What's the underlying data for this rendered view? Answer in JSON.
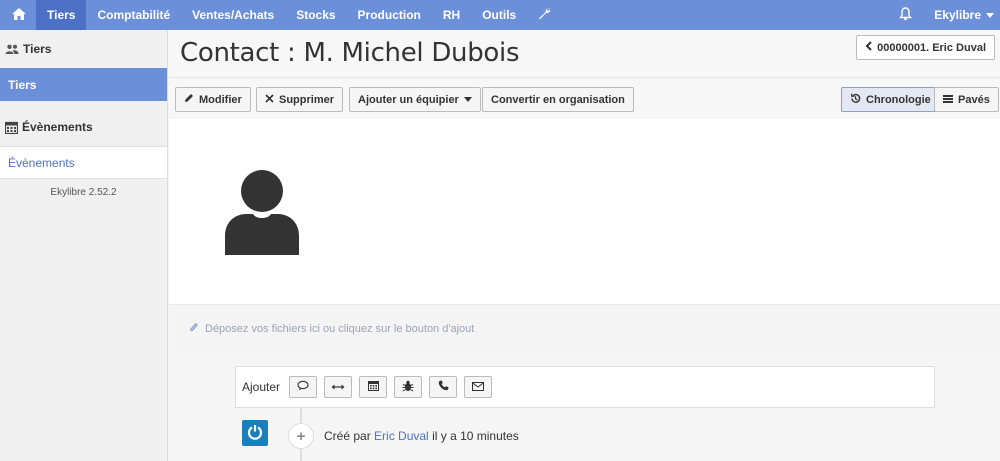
{
  "nav": {
    "home_icon": "home-icon",
    "items": [
      "Tiers",
      "Comptabilité",
      "Ventes/Achats",
      "Stocks",
      "Production",
      "RH",
      "Outils"
    ],
    "active": "Tiers",
    "wrench_icon": "wrench-icon",
    "bell_icon": "bell-icon",
    "user": "Ekylibre"
  },
  "sidebar": {
    "tiers_section": "Tiers",
    "tiers_active": "Tiers",
    "events_section": "Évènements",
    "events_link": "Évènements",
    "version": "Ekylibre 2.52.2"
  },
  "page": {
    "title": "Contact : M. Michel Dubois",
    "back_button": "00000001. Eric Duval"
  },
  "toolbar": {
    "modify": "Modifier",
    "delete": "Supprimer",
    "add_equipment": "Ajouter un équipier",
    "convert": "Convertir en organisation",
    "chronology": "Chronologie",
    "tiles": "Pavés"
  },
  "dropzone": {
    "text": "Déposez vos fichiers ici ou cliquez sur le bouton d'ajout"
  },
  "add_panel": {
    "label": "Ajouter",
    "icons": [
      "comment-icon",
      "exchange-icon",
      "calendar-icon",
      "bug-icon",
      "phone-icon",
      "envelope-icon"
    ]
  },
  "timeline": {
    "created_prefix": "Créé par",
    "author": "Eric Duval",
    "when": "il y a 10 minutes"
  },
  "colors": {
    "navbar": "#6b8fd8",
    "navbar_active": "#4d71c4",
    "link": "#4d71c4"
  }
}
